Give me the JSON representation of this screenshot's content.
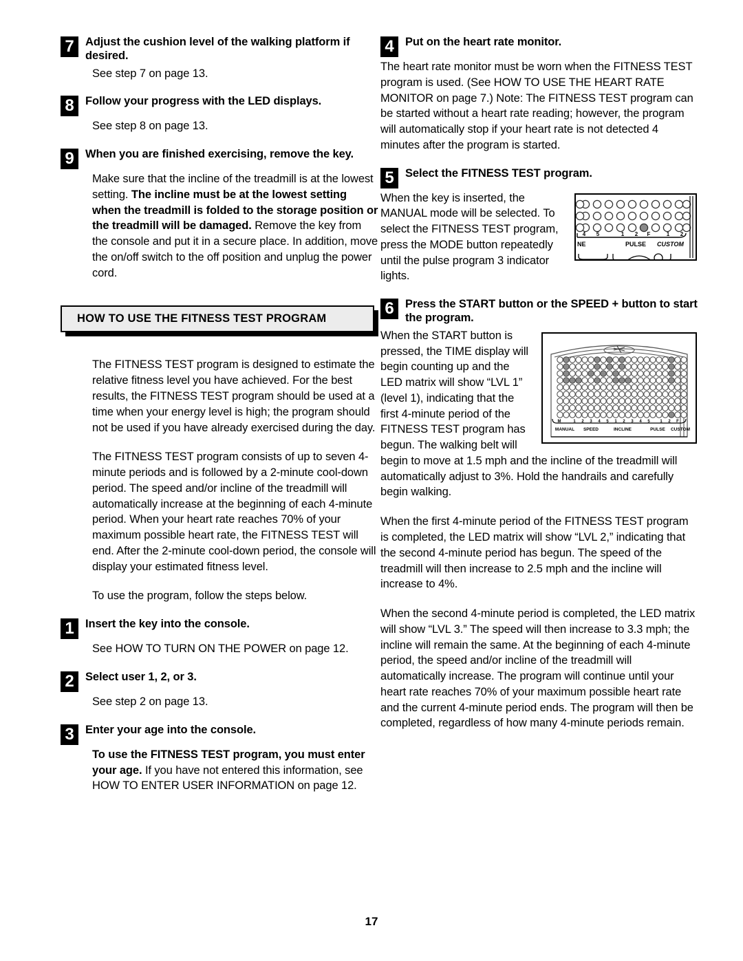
{
  "page": {
    "number": "17"
  },
  "left_column": {
    "steps": [
      {
        "num": "7",
        "title": "Adjust the cushion level of the walking platform if desired.",
        "body": "See step 7 on page 13."
      },
      {
        "num": "8",
        "title": "Follow your progress with the LED displays.",
        "body": "See step 8 on page 13."
      },
      {
        "num": "9",
        "title": "When you are finished exercising, remove the key.",
        "body_pre": "Make sure that the incline of the treadmill is at the lowest setting. ",
        "body_bold": "The incline must be at the lowest setting when the treadmill is folded to the storage position or the treadmill will be damaged.",
        "body_post": " Remove the key from the console and put it in a secure place. In addition, move the on/off switch to the off position and unplug the power cord."
      }
    ],
    "section_header": "HOW TO USE THE FITNESS TEST PROGRAM",
    "intro_paragraphs": [
      "The FITNESS TEST program is designed to estimate the relative fitness level you have achieved. For the best results, the FITNESS TEST program should be used at a time when your energy level is high; the program should not be used if you have already exercised during the day.",
      "The FITNESS TEST program consists of up to seven 4-minute periods and is followed by a 2-minute cool-down period. The speed and/or incline of the treadmill will automatically increase at the beginning of each 4-minute period. When your heart rate reaches 70% of your maximum possible heart rate, the FITNESS TEST will end. After the 2-minute cool-down period, the console will display your estimated fitness level.",
      "To use the program, follow the steps below."
    ],
    "numbered_steps": [
      {
        "num": "1",
        "title": "Insert the key into the console.",
        "body": "See HOW TO TURN ON THE POWER on page 12."
      },
      {
        "num": "2",
        "title": "Select user 1, 2, or 3.",
        "body": "See step 2 on page 13."
      },
      {
        "num": "3",
        "title": "Enter your age into the console.",
        "body_bold": "To use the FITNESS TEST program, you must enter your age.",
        "body_post": " If you have not entered this information, see HOW TO ENTER USER INFORMATION on page 12."
      }
    ]
  },
  "right_column": {
    "steps": [
      {
        "num": "4",
        "title": "Put on the heart rate monitor.",
        "body": "The heart rate monitor must be worn when the FITNESS TEST program is used. (See HOW TO USE THE HEART RATE MONITOR on page 7.) Note: The FITNESS TEST program can be started without a heart rate reading; however, the program will automatically stop if your heart rate is not detected 4 minutes after the program is started."
      },
      {
        "num": "5",
        "title": "Select the FITNESS TEST program.",
        "body": "When the key is inserted, the MANUAL mode will be selected. To select the FITNESS TEST program, press the MODE button repeatedly until the pulse program 3 indicator lights."
      },
      {
        "num": "6",
        "title": "Press the START button or the SPEED + button to start the program.",
        "body_1": "When the START button is pressed, the TIME display will begin counting up and the LED matrix will show “LVL 1” (level 1), indicating that the first 4-minute period of the FITNESS TEST program has begun. The walking belt will begin to move at 1.5 mph and the incline of the treadmill will automatically adjust to 3%. Hold the handrails and carefully begin walking.",
        "body_2": "When the first 4-minute period of the FITNESS TEST program is completed, the LED matrix will show “LVL 2,” indicating that the second 4-minute period has begun. The speed of the treadmill will then increase to 2.5 mph and the incline will increase to 4%.",
        "body_3": "When the second 4-minute period is completed, the LED matrix will show “LVL 3.” The speed will then increase to 3.3 mph; the incline will remain the same. At the beginning of each 4-minute period, the speed and/or incline of the treadmill will automatically increase. The program will continue until your heart rate reaches 70% of your maximum possible heart rate and the current 4-minute period ends. The program will then be completed, regardless of how many 4-minute periods remain."
      }
    ]
  },
  "figures": {
    "console_detail": {
      "name": "console-pulse-detail",
      "rows": 3,
      "cols": 11,
      "lit_row": 3,
      "lit_col": 6,
      "tick_labels": [
        "4",
        "5",
        "1",
        "2",
        "F",
        "1",
        "2"
      ],
      "group_labels": [
        "NE",
        "PULSE",
        "CUSTOM"
      ]
    },
    "console_full": {
      "name": "console-led-matrix",
      "display_text": "LVL 1",
      "rows": 10,
      "cols": 21,
      "tick_labels": [
        "M",
        "1",
        "2",
        "3",
        "4",
        "5",
        "1",
        "2",
        "3",
        "4",
        "5",
        "1",
        "2",
        "F",
        "1",
        "2"
      ],
      "group_labels": [
        "MANUAL",
        "SPEED",
        "INCLINE",
        "PULSE",
        "CUSTOM"
      ],
      "lit_indicator": "PULSE F"
    }
  },
  "colors": {
    "ink": "#000000",
    "paper": "#ffffff",
    "section_bar_bg": "#ececec",
    "led_lit": "#8a8a8a",
    "led_off": "#ffffff"
  }
}
